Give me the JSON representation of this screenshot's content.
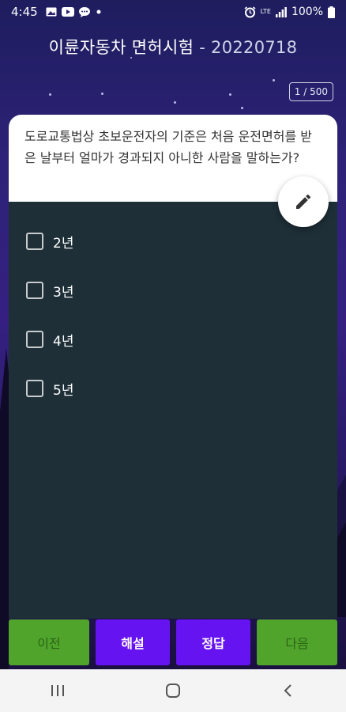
{
  "status_bar": {
    "time": "4:45",
    "network": "LTE",
    "battery": "100%",
    "notification_icons": [
      "gallery-icon",
      "youtube-icon",
      "chat-icon",
      "dot-icon"
    ]
  },
  "header": {
    "title": "이륜자동차 면허시험 ",
    "separator": "- ",
    "date": "20220718"
  },
  "progress": {
    "label": "1 / 500"
  },
  "question": {
    "text": "도로교통법상 초보운전자의 기준은 처음 운전면허를 받은 날부터 얼마가 경과되지 아니한 사람을 말하는가?"
  },
  "options": [
    {
      "label": "2년",
      "checked": false
    },
    {
      "label": "3년",
      "checked": false
    },
    {
      "label": "4년",
      "checked": false
    },
    {
      "label": "5년",
      "checked": false
    }
  ],
  "buttons": {
    "prev": "이전",
    "explanation": "해설",
    "answer": "정답",
    "next": "다음"
  },
  "colors": {
    "accent_green": "#50a42b",
    "accent_purple": "#6513f0",
    "card_bg": "#1e2f38"
  },
  "fab_icon": "pencil-icon"
}
